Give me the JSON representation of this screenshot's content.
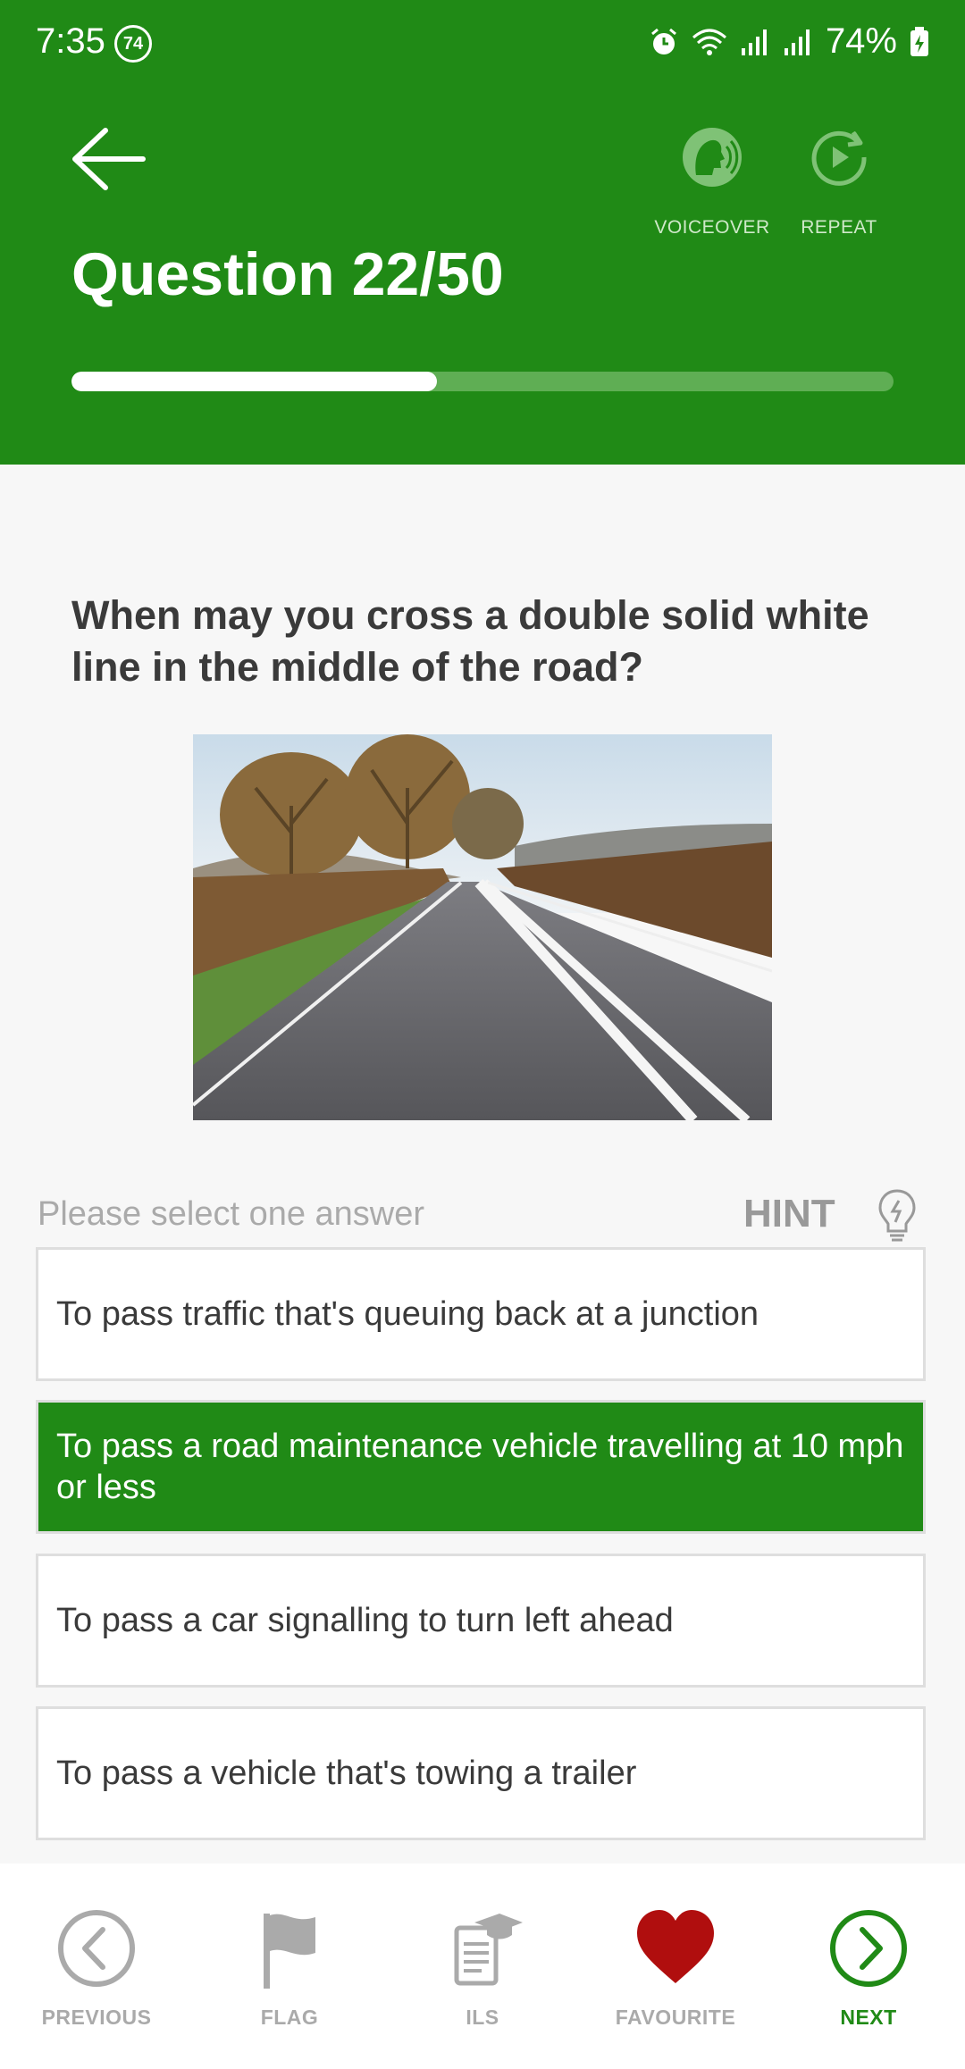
{
  "status": {
    "time": "7:35",
    "badge": "74",
    "battery": "74%"
  },
  "header": {
    "title": "Question 22/50",
    "voiceover_label": "VOICEOVER",
    "repeat_label": "REPEAT",
    "progress_fraction": 0.445
  },
  "question": {
    "text": "When may you cross a double solid white line in the middle of the road?"
  },
  "answers_section": {
    "instruction": "Please select one answer",
    "hint_label": "HINT"
  },
  "answers": [
    {
      "text": "To pass traffic that's queuing back at a junction",
      "selected": false
    },
    {
      "text": "To pass a road maintenance vehicle travelling at 10 mph or less",
      "selected": true
    },
    {
      "text": "To pass a car signalling to turn left ahead",
      "selected": false
    },
    {
      "text": "To pass a vehicle that's towing a trailer",
      "selected": false
    }
  ],
  "nav": {
    "previous": "PREVIOUS",
    "flag": "FLAG",
    "ils": "ILS",
    "favourite": "FAVOURITE",
    "next": "NEXT"
  },
  "colors": {
    "brand_green": "#208a16",
    "favourite_red": "#b00e0e"
  },
  "icons": [
    "back-arrow-icon",
    "voiceover-icon",
    "repeat-icon",
    "lightbulb-icon",
    "previous-icon",
    "flag-icon",
    "ils-icon",
    "heart-icon",
    "next-icon"
  ]
}
